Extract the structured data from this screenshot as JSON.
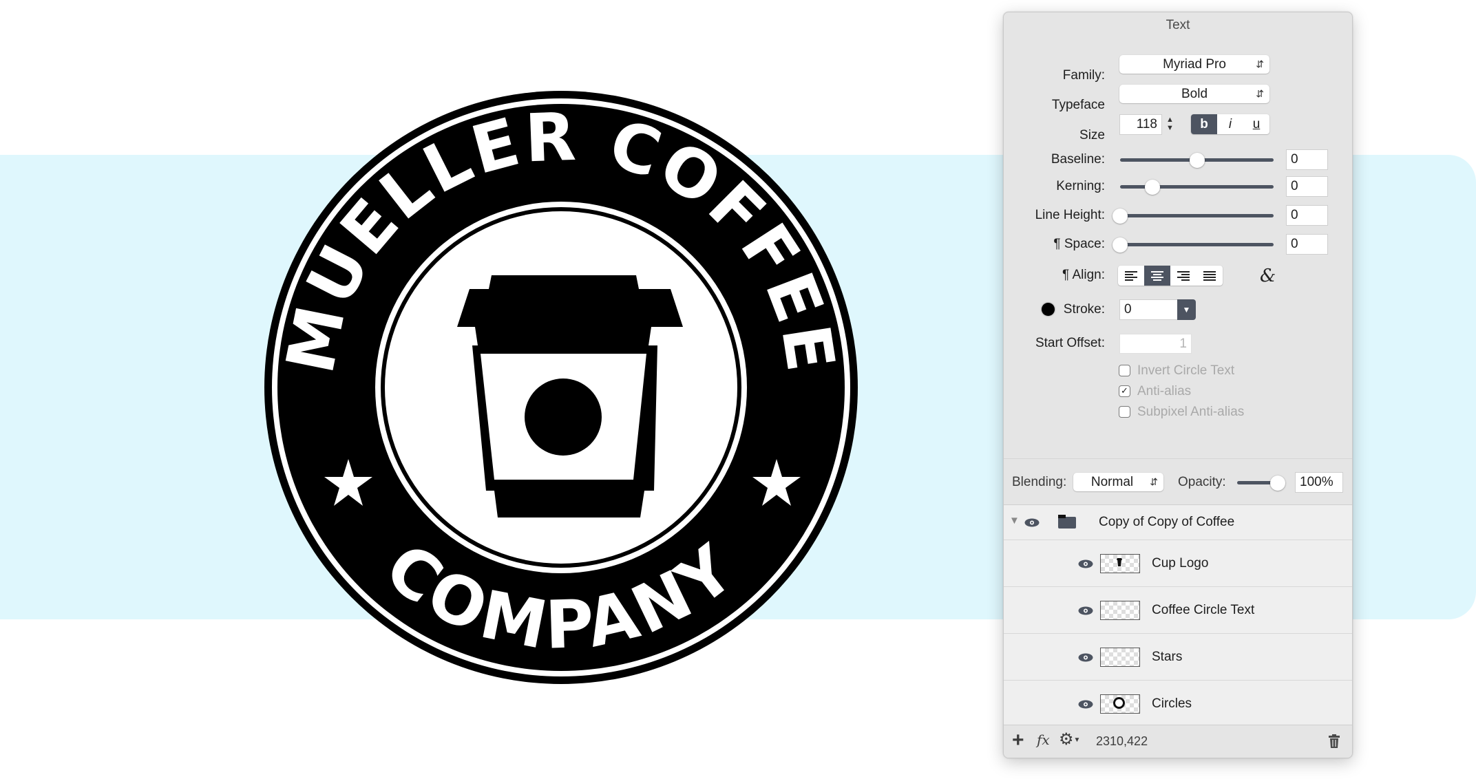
{
  "canvas": {
    "band_color": "#dff7fd",
    "logo": {
      "top_text": "MUELLER COFFEE",
      "bottom_text": "COMPANY",
      "ink_color": "#000000",
      "paper_color": "#ffffff"
    }
  },
  "text_panel": {
    "title": "Text",
    "family": {
      "label": "Family:",
      "value": "Myriad Pro"
    },
    "typeface": {
      "label": "Typeface",
      "value": "Bold"
    },
    "size": {
      "label": "Size",
      "value": "118",
      "styles": [
        {
          "label": "b",
          "active": true
        },
        {
          "label": "i",
          "active": false
        },
        {
          "label": "u",
          "active": false
        }
      ]
    },
    "sliders": [
      {
        "label": "Baseline:",
        "value": "0",
        "position": 0.5
      },
      {
        "label": "Kerning:",
        "value": "0",
        "position": 0.21
      },
      {
        "label": "Line Height:",
        "value": "0",
        "position": 0.0
      },
      {
        "label": "¶ Space:",
        "value": "0",
        "position": 0.0
      }
    ],
    "align": {
      "label": "¶ Align:",
      "options": [
        "left",
        "center",
        "right",
        "justify"
      ],
      "selected": "center",
      "ligature_glyph": "&"
    },
    "stroke": {
      "label": "Stroke:",
      "value": "0",
      "color": "#000000"
    },
    "start_offset": {
      "label": "Start Offset:",
      "value": "1"
    },
    "checkboxes": [
      {
        "label": "Invert Circle Text",
        "checked": false
      },
      {
        "label": "Anti-alias",
        "checked": true
      },
      {
        "label": "Subpixel Anti-alias",
        "checked": false
      }
    ]
  },
  "layers_panel": {
    "blending": {
      "label": "Blending:",
      "value": "Normal"
    },
    "opacity": {
      "label": "Opacity:",
      "value": "100%",
      "position": 1.0
    },
    "group": {
      "name": "Copy of Copy of Coffee",
      "expanded": true,
      "visible": true
    },
    "layers": [
      {
        "name": "Cup Logo",
        "visible": true,
        "thumb": "cup"
      },
      {
        "name": "Coffee Circle Text",
        "visible": true,
        "thumb": "empty"
      },
      {
        "name": "Stars",
        "visible": true,
        "thumb": "empty"
      },
      {
        "name": "Circles",
        "visible": true,
        "thumb": "circle"
      }
    ],
    "footer": {
      "coords": "2310,422",
      "add_glyph": "+",
      "fx_glyph": "fx"
    }
  }
}
